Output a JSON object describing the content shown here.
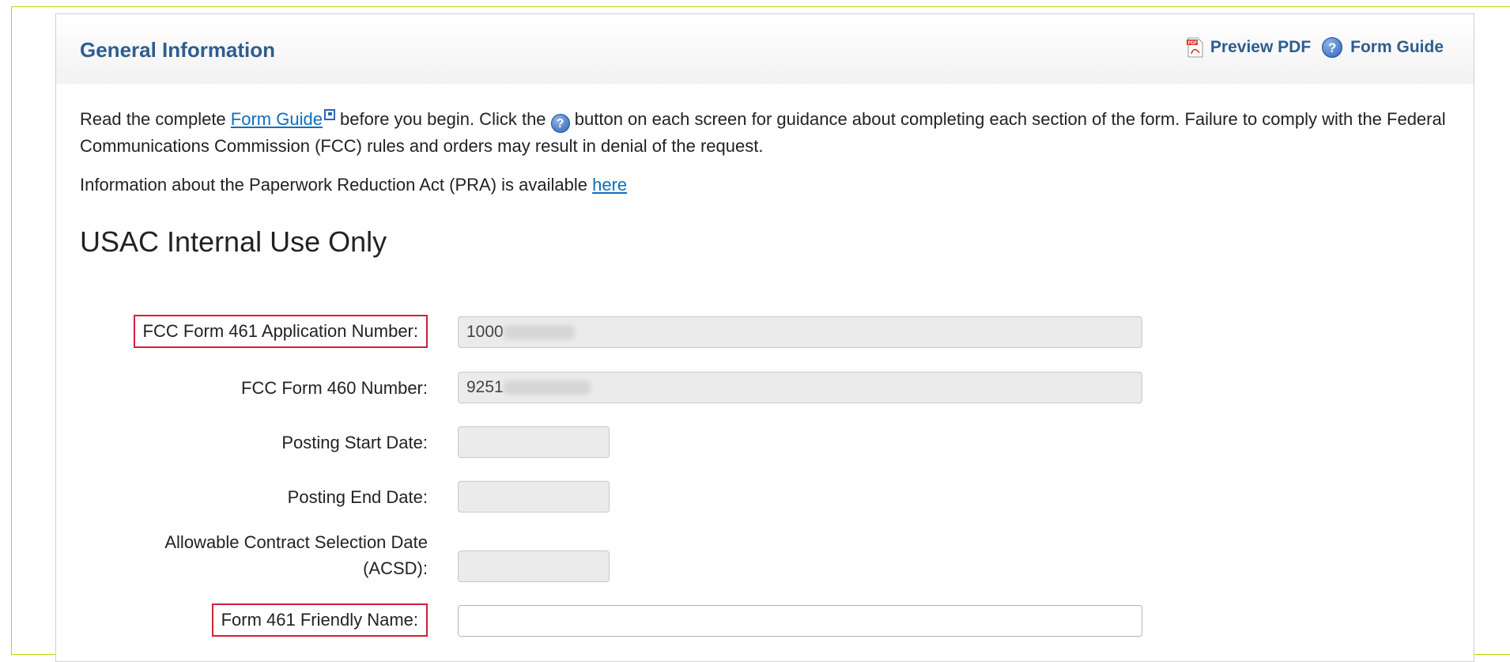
{
  "header": {
    "title": "General Information",
    "preview_pdf": "Preview PDF",
    "form_guide": "Form Guide"
  },
  "intro": {
    "part1": "Read the complete ",
    "form_guide_link": "Form Guide",
    "part2": " before you begin. Click the ",
    "part3": " button on each screen for guidance about completing each section of the form. Failure to comply with the Federal Communications Commission (FCC) rules and orders may result in denial of the request.",
    "pra_text": "Information about the Paperwork Reduction Act (PRA) is available ",
    "pra_link": "here"
  },
  "section": {
    "title": "USAC Internal Use Only"
  },
  "fields": {
    "app_number": {
      "label": "FCC Form 461 Application Number:",
      "value": "1000"
    },
    "form460": {
      "label": "FCC Form 460 Number:",
      "value": "9251"
    },
    "posting_start": {
      "label": "Posting Start Date:",
      "value": ""
    },
    "posting_end": {
      "label": "Posting End Date:",
      "value": ""
    },
    "acsd_line1": "Allowable Contract Selection Date",
    "acsd_line2": "(ACSD):",
    "acsd_value": "",
    "friendly_name": {
      "label": "Form 461 Friendly Name:",
      "value": ""
    }
  },
  "icons": {
    "pdf": "pdf-icon",
    "help": "help-icon",
    "external": "external-link-icon"
  },
  "colors": {
    "title_blue": "#2e5d8f",
    "link_blue": "#0c6fc0",
    "highlight_red": "#d1203b",
    "frame_yellow": "#c8d200"
  }
}
